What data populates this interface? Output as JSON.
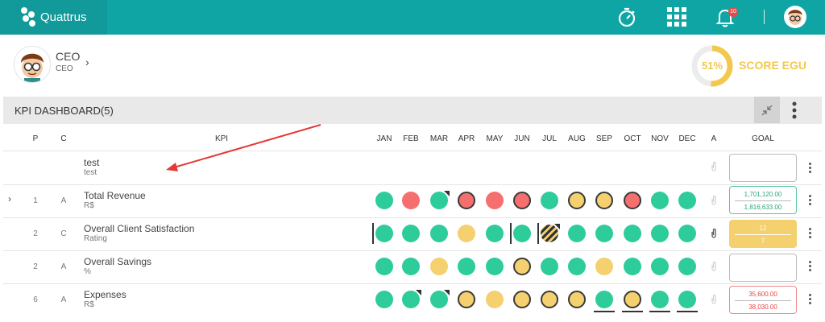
{
  "topbar": {
    "app_name": "Quattrus",
    "notification_count": "10",
    "icons": [
      "stopwatch-icon",
      "apps-grid-icon",
      "bell-icon",
      "user-avatar"
    ]
  },
  "user": {
    "name": "CEO",
    "role": "CEO"
  },
  "score": {
    "percent": "51%",
    "label": "SCORE EGU",
    "value": 0.51,
    "color": "#f2c94c"
  },
  "dashboard": {
    "title": "KPI DASHBOARD(5)"
  },
  "columns": {
    "p": "P",
    "c": "C",
    "kpi": "KPI",
    "months": [
      "JAN",
      "FEB",
      "MAR",
      "APR",
      "MAY",
      "JUN",
      "JUL",
      "AUG",
      "SEP",
      "OCT",
      "NOV",
      "DEC"
    ],
    "a": "A",
    "goal": "GOAL"
  },
  "rows": [
    {
      "p": "",
      "c": "",
      "name": "test",
      "unit": "test",
      "goal_top": "",
      "goal_bottom": ""
    },
    {
      "p": "1",
      "c": "A",
      "name": "Total Revenue",
      "unit": "R$",
      "goal_top": "1,701,120.00",
      "goal_bottom": "1,816,633.00"
    },
    {
      "p": "2",
      "c": "C",
      "name": "Overall Client Satisfaction",
      "unit": "Rating",
      "goal_top": "12",
      "goal_bottom": "7"
    },
    {
      "p": "2",
      "c": "A",
      "name": "Overall Savings",
      "unit": "%",
      "goal_top": "",
      "goal_bottom": ""
    },
    {
      "p": "6",
      "c": "A",
      "name": "Expenses",
      "unit": "R$",
      "goal_top": "35,600.00",
      "goal_bottom": "38,030.00"
    }
  ],
  "colors": {
    "green": "#2ecc9a",
    "red": "#f56f6f",
    "yellow": "#f4d06f",
    "teal": "#0fa5a5"
  }
}
